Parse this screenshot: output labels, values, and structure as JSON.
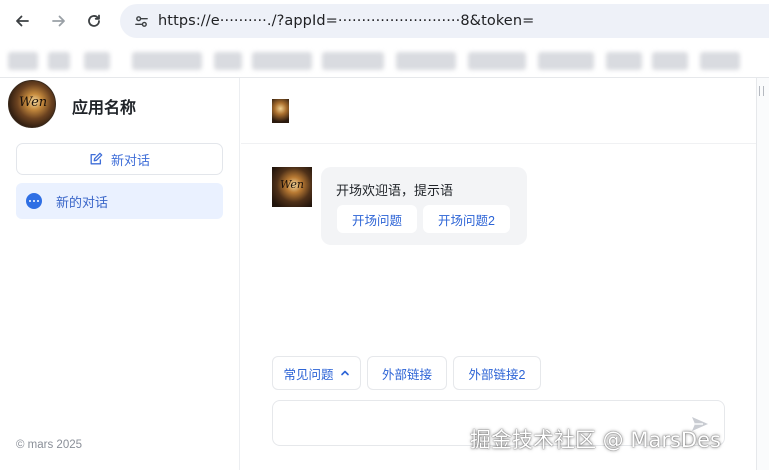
{
  "browser": {
    "url": "https://e··········./?appId=··························8&token=",
    "icons": [
      "back-icon",
      "forward-icon",
      "reload-icon",
      "site-settings-icon"
    ]
  },
  "sidebar": {
    "app_name": "应用名称",
    "logo_text": "Wen",
    "new_chat_label": "新对话",
    "conversations": [
      {
        "label": "新的对话",
        "active": true
      }
    ],
    "copyright": "© mars 2025"
  },
  "chat": {
    "welcome": "开场欢迎语，提示语",
    "suggestions": [
      "开场问题",
      "开场问题2"
    ],
    "quick_actions": [
      "常见问题",
      "外部链接",
      "外部链接2"
    ],
    "input_placeholder": ""
  },
  "watermark": "掘金技术社区 @ MarsDes",
  "colors": {
    "accent": "#2d64d6",
    "active_bg": "#eaf1ff",
    "bubble_bg": "#f3f4f6"
  }
}
